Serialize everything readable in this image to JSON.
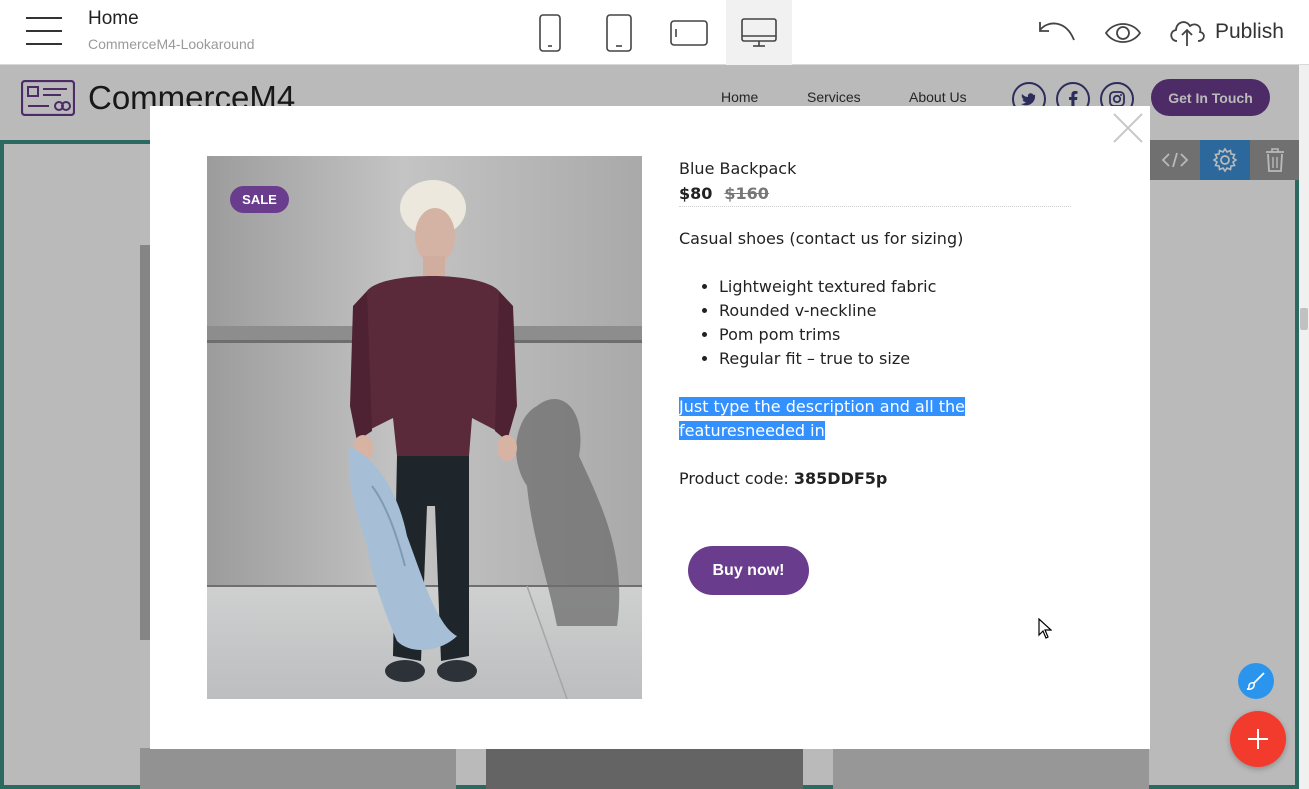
{
  "editor": {
    "page_title": "Home",
    "project_name": "CommerceM4-Lookaround",
    "publish_label": "Publish",
    "active_device": "desktop"
  },
  "site": {
    "brand": "CommerceM4",
    "nav": [
      "Home",
      "Services",
      "About Us"
    ],
    "social": [
      "twitter",
      "facebook",
      "instagram"
    ],
    "cta_label": "Get In Touch"
  },
  "modal": {
    "badge": "SALE",
    "product_name": "Blue Backpack",
    "price_new": "$80",
    "price_old": "$160",
    "description": "Casual shoes (contact us for sizing)",
    "features": [
      "Lightweight textured fabric",
      "Rounded v-neckline",
      "Pom pom trims",
      "Regular fit – true to size"
    ],
    "selected_text_line1": "Just type the description and all the ",
    "selected_text_line2": "featuresneeded in",
    "code_label": "Product code:",
    "code_value": "385DDF5p",
    "buy_label": "Buy now!"
  },
  "colors": {
    "brand_purple": "#6a3c8d",
    "selection_blue": "#3390ff",
    "fab_red": "#f23a2d",
    "fab_blue": "#2b95ee",
    "active_block_border": "#3b9085",
    "block_tools_bg": "#9a9a9a",
    "settings_active_bg": "#3d8fd6"
  },
  "icons": {
    "toolbar": [
      "hamburger-icon",
      "mobile-icon",
      "tablet-icon",
      "tablet-landscape-icon",
      "desktop-icon",
      "undo-icon",
      "preview-eye-icon",
      "cloud-upload-icon"
    ],
    "block_tools": [
      "code-icon",
      "gear-icon",
      "trash-icon"
    ],
    "modal": [
      "close-icon"
    ],
    "fabs": [
      "brush-icon",
      "plus-icon"
    ]
  }
}
